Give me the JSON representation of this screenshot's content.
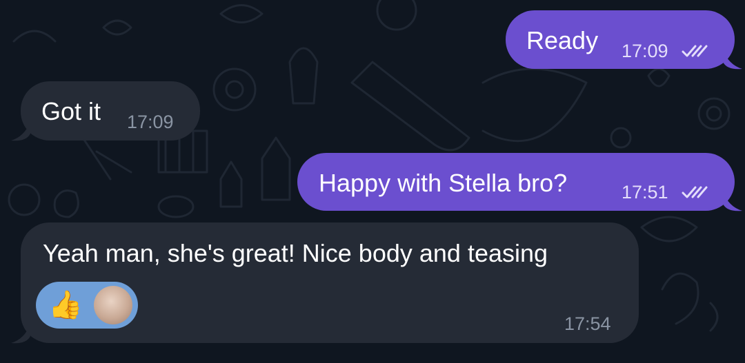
{
  "chat": {
    "messages": [
      {
        "direction": "outgoing",
        "text": "Ready",
        "time": "17:09",
        "status": "read"
      },
      {
        "direction": "incoming",
        "text": "Got it",
        "time": "17:09"
      },
      {
        "direction": "outgoing",
        "text": "Happy with Stella bro?",
        "time": "17:51",
        "status": "read"
      },
      {
        "direction": "incoming",
        "text": "Yeah man, she's great! Nice body and teasing",
        "time": "17:54",
        "reactions": [
          {
            "emoji": "👍",
            "reactor_avatar": true
          }
        ]
      }
    ]
  },
  "colors": {
    "background": "#0f1620",
    "outgoing_bubble": "#6b4fcf",
    "incoming_bubble": "#252b36",
    "reaction_pill": "#6f9fd8",
    "text": "#ffffff"
  },
  "icons": {
    "read_status": "double-check-icon",
    "reaction": "thumbs-up-icon"
  }
}
